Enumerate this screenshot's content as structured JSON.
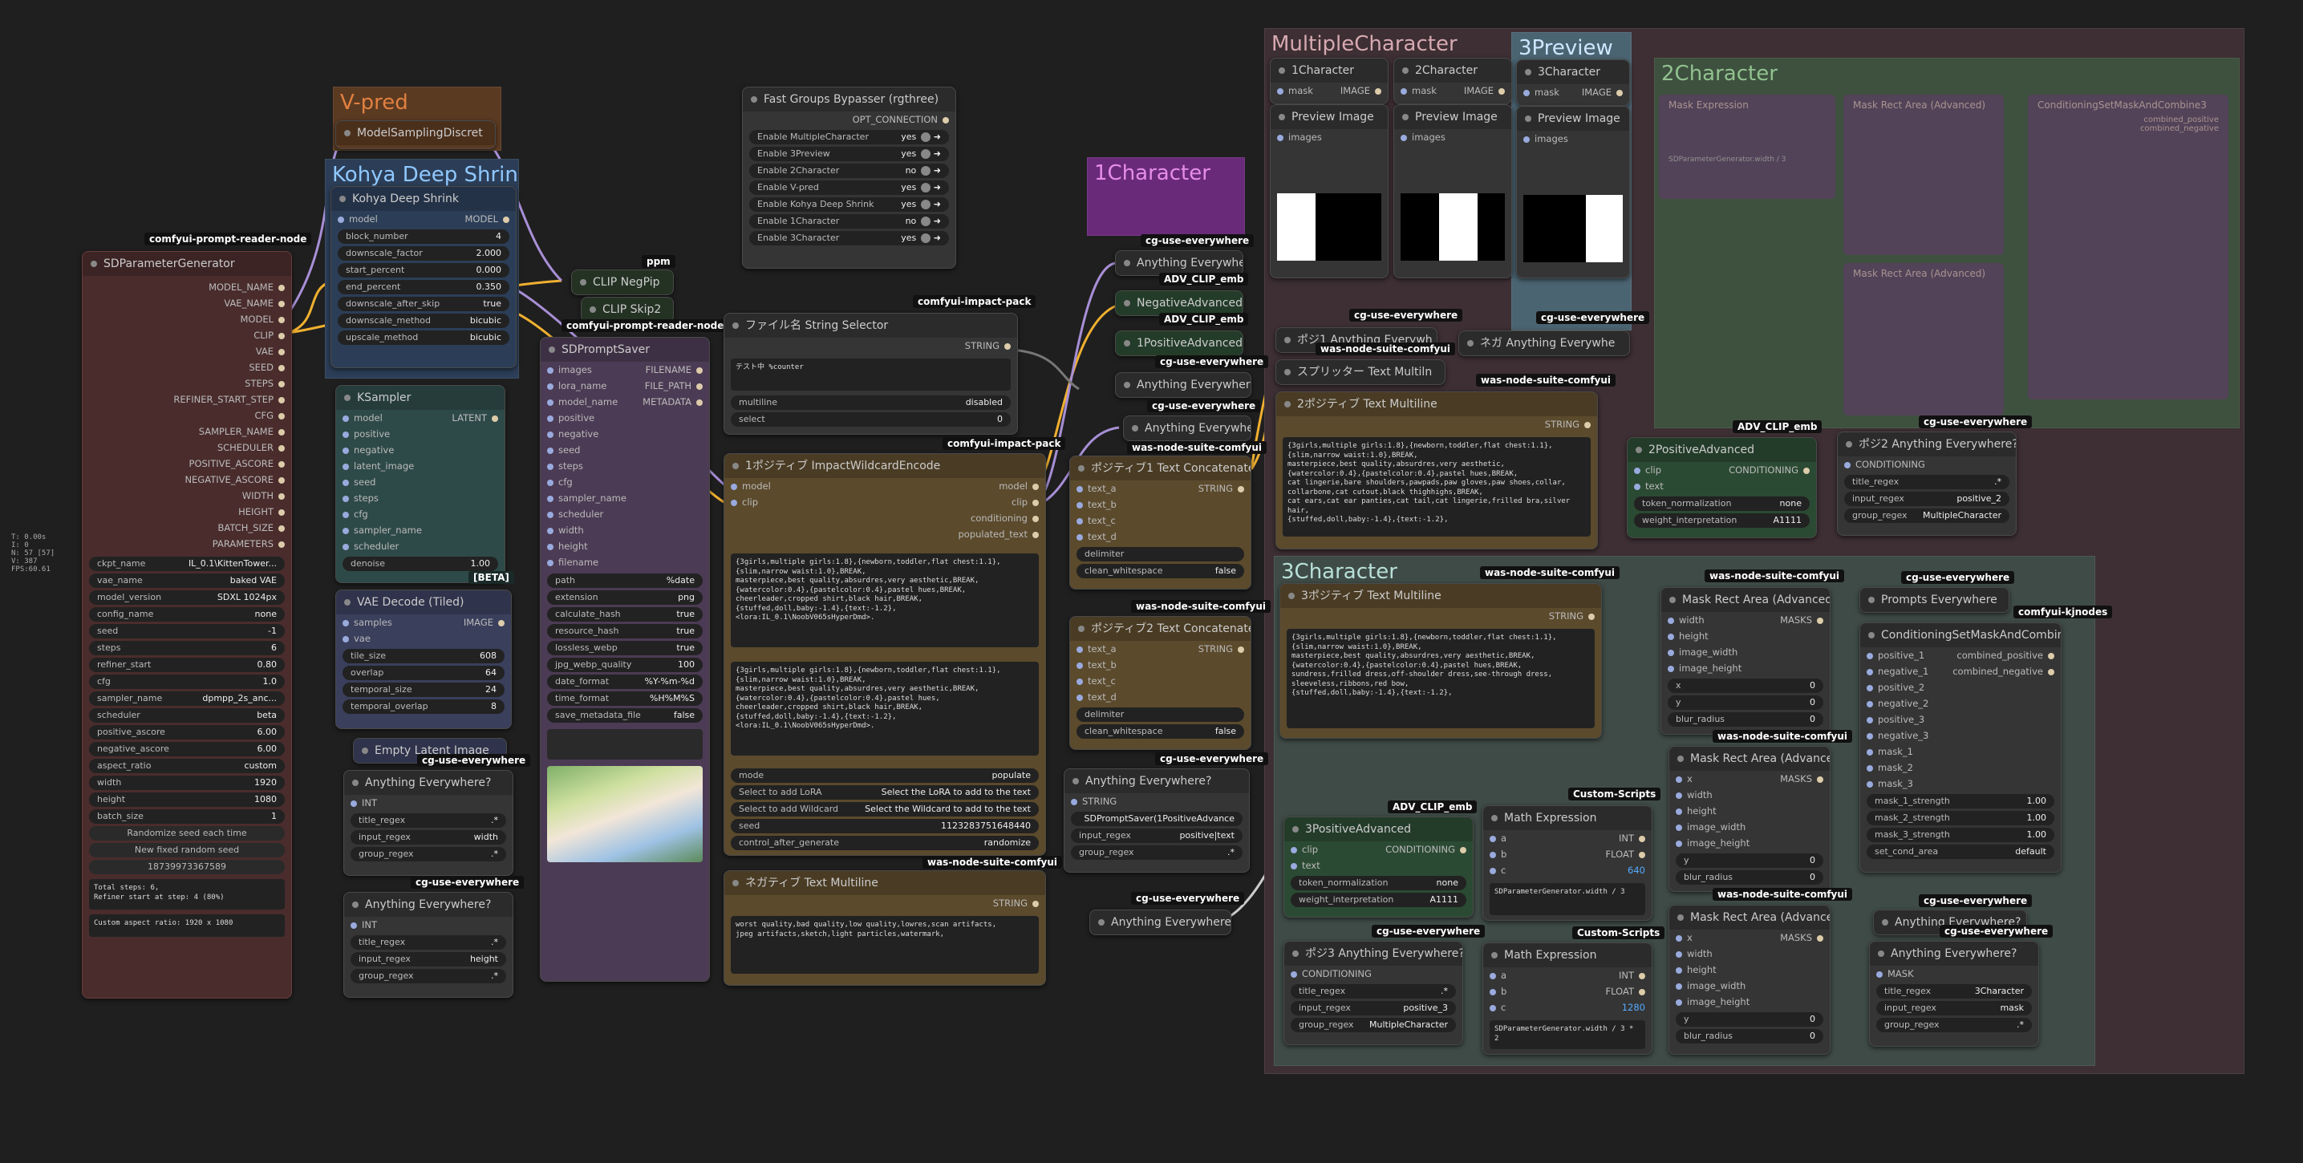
{
  "colors": {
    "green_node": "#2b4a33",
    "brown_node": "#5b4a2c",
    "purple_node": "#4c3b54",
    "teal_node": "#2e4a48",
    "red_node": "#4a2c2c",
    "blue_node": "#3a3f5c"
  },
  "stats": {
    "lines": [
      "T: 0.00s",
      "I: 0",
      "N: 57 [57]",
      "V: 387",
      "FPS:60.61"
    ]
  },
  "groups": {
    "vpred": "V-pred",
    "kohya": "Kohya Deep Shrink",
    "multiple": "MultipleCharacter",
    "preview3": "3Preview",
    "char1": "1Character",
    "char2": "2Character",
    "char3": "3Character"
  },
  "tags": {
    "reader": "comfyui-prompt-reader-node",
    "ppm": "ppm",
    "reader2": "comfyui-prompt-reader-node",
    "impact": "comfyui-impact-pack",
    "impact2": "comfyui-impact-pack",
    "cgue": "cg-use-everywhere",
    "adv": "ADV_CLIP_emb",
    "was": "was-node-suite-comfyui",
    "custom": "Custom-Scripts",
    "kjnodes": "comfyui-kjnodes",
    "beta": "[BETA]"
  },
  "sdparam": {
    "title": "SDParameterGenerator",
    "outputs": [
      "MODEL_NAME",
      "VAE_NAME",
      "MODEL",
      "CLIP",
      "VAE",
      "SEED",
      "STEPS",
      "REFINER_START_STEP",
      "CFG",
      "SAMPLER_NAME",
      "SCHEDULER",
      "POSITIVE_ASCORE",
      "NEGATIVE_ASCORE",
      "WIDTH",
      "HEIGHT",
      "BATCH_SIZE",
      "PARAMETERS"
    ],
    "widgets": [
      {
        "k": "ckpt_name",
        "v": "IL_0.1\\KittenTower..."
      },
      {
        "k": "vae_name",
        "v": "baked VAE"
      },
      {
        "k": "model_version",
        "v": "SDXL 1024px"
      },
      {
        "k": "config_name",
        "v": "none"
      },
      {
        "k": "seed",
        "v": "-1"
      },
      {
        "k": "steps",
        "v": "6"
      },
      {
        "k": "refiner_start",
        "v": "0.80"
      },
      {
        "k": "cfg",
        "v": "1.0"
      },
      {
        "k": "sampler_name",
        "v": "dpmpp_2s_anc..."
      },
      {
        "k": "scheduler",
        "v": "beta"
      },
      {
        "k": "positive_ascore",
        "v": "6.00"
      },
      {
        "k": "negative_ascore",
        "v": "6.00"
      },
      {
        "k": "aspect_ratio",
        "v": "custom"
      },
      {
        "k": "width",
        "v": "1920"
      },
      {
        "k": "height",
        "v": "1080"
      },
      {
        "k": "batch_size",
        "v": "1"
      }
    ],
    "buttons": [
      "Randomize seed each time",
      "New fixed random seed",
      "18739973367589"
    ],
    "info1": "Total steps: 6,\nRefiner start at step: 4 (80%)",
    "info2": "Custom aspect ratio: 1920 x 1080"
  },
  "msd": {
    "title": "ModelSamplingDiscret"
  },
  "kohya": {
    "title": "Kohya Deep Shrink",
    "in": "model",
    "out": "MODEL",
    "widgets": [
      {
        "k": "block_number",
        "v": "4"
      },
      {
        "k": "downscale_factor",
        "v": "2.000"
      },
      {
        "k": "start_percent",
        "v": "0.000"
      },
      {
        "k": "end_percent",
        "v": "0.350"
      },
      {
        "k": "downscale_after_skip",
        "v": "true"
      },
      {
        "k": "downscale_method",
        "v": "bicubic"
      },
      {
        "k": "upscale_method",
        "v": "bicubic"
      }
    ]
  },
  "clipneg": {
    "title": "CLIP NegPip"
  },
  "clipskip": {
    "title": "CLIP Skip2"
  },
  "ksampler": {
    "title": "KSampler",
    "inputs": [
      "model",
      "positive",
      "negative",
      "latent_image",
      "seed",
      "steps",
      "cfg",
      "sampler_name",
      "scheduler"
    ],
    "out": "LATENT",
    "denoise_k": "denoise",
    "denoise_v": "1.00"
  },
  "vaedec": {
    "title": "VAE Decode (Tiled)",
    "inputs": [
      "samples",
      "vae"
    ],
    "out": "IMAGE",
    "widgets": [
      {
        "k": "tile_size",
        "v": "608"
      },
      {
        "k": "overlap",
        "v": "64"
      },
      {
        "k": "temporal_size",
        "v": "24"
      },
      {
        "k": "temporal_overlap",
        "v": "8"
      }
    ]
  },
  "emptylatent": {
    "title": "Empty Latent Image"
  },
  "ae1": {
    "title": "Anything Everywhere?",
    "in": "INT",
    "widgets": [
      {
        "k": "title_regex",
        "v": ".*"
      },
      {
        "k": "input_regex",
        "v": "width"
      },
      {
        "k": "group_regex",
        "v": ".*"
      }
    ]
  },
  "ae2": {
    "title": "Anything Everywhere?",
    "in": "INT",
    "widgets": [
      {
        "k": "title_regex",
        "v": ".*"
      },
      {
        "k": "input_regex",
        "v": "height"
      },
      {
        "k": "group_regex",
        "v": ".*"
      }
    ]
  },
  "saver": {
    "title": "SDPromptSaver",
    "inputs": [
      "images",
      "lora_name",
      "model_name",
      "positive",
      "negative",
      "seed",
      "steps",
      "cfg",
      "sampler_name",
      "scheduler",
      "width",
      "height",
      "filename"
    ],
    "outputs": [
      "FILENAME",
      "FILE_PATH",
      "METADATA"
    ],
    "widgets": [
      {
        "k": "path",
        "v": "%date"
      },
      {
        "k": "extension",
        "v": "png"
      },
      {
        "k": "calculate_hash",
        "v": "true"
      },
      {
        "k": "resource_hash",
        "v": "true"
      },
      {
        "k": "lossless_webp",
        "v": "true"
      },
      {
        "k": "jpg_webp_quality",
        "v": "100"
      },
      {
        "k": "date_format",
        "v": "%Y-%m-%d"
      },
      {
        "k": "time_format",
        "v": "%H%M%S"
      },
      {
        "k": "save_metadata_file",
        "v": "false"
      }
    ]
  },
  "bypass": {
    "title": "Fast Groups Bypasser (rgthree)",
    "out": "OPT_CONNECTION",
    "rows": [
      {
        "k": "Enable MultipleCharacter",
        "v": "yes"
      },
      {
        "k": "Enable 3Preview",
        "v": "yes"
      },
      {
        "k": "Enable 2Character",
        "v": "no"
      },
      {
        "k": "Enable V-pred",
        "v": "yes"
      },
      {
        "k": "Enable Kohya Deep Shrink",
        "v": "yes"
      },
      {
        "k": "Enable 1Character",
        "v": "no"
      },
      {
        "k": "Enable 3Character",
        "v": "yes"
      }
    ]
  },
  "fname": {
    "title": "ファイル名 String Selector",
    "out": "STRING",
    "text": "テスト中 %counter",
    "widgets": [
      {
        "k": "multiline",
        "v": "disabled"
      },
      {
        "k": "select",
        "v": "0"
      }
    ]
  },
  "wildcard": {
    "title": "1ポジティブ ImpactWildcardEncode",
    "inputs": [
      "model",
      "clip"
    ],
    "outputs": [
      "model",
      "clip",
      "conditioning",
      "populated_text"
    ],
    "text1": "{3girls,multiple girls:1.8},{newborn,toddler,flat chest:1.1},{slim,narrow waist:1.0},BREAK,\nmasterpiece,best quality,absurdres,very aesthetic,BREAK,\n{watercolor:0.4},{pastelcolor:0.4},pastel hues,BREAK,\ncheerleader,cropped shirt,black hair,BREAK,\n{stuffed,doll,baby:-1.4},{text:-1.2},\n<lora:IL_0.1\\NoobV065sHyperDmd>.",
    "text2": "{3girls,multiple girls:1.8},{newborn,toddler,flat chest:1.1},{slim,narrow waist:1.0},BREAK,\nmasterpiece,best quality,absurdres,very aesthetic,BREAK,\n{watercolor:0.4},{pastelcolor:0.4},pastel hues,\ncheerleader,cropped shirt,black hair,BREAK,\n{stuffed,doll,baby:-1.4},{text:-1.2},\n<lora:IL_0.1\\NoobV065sHyperDmd>.",
    "widgets": [
      {
        "k": "mode",
        "v": "populate"
      },
      {
        "k": "Select to add LoRA",
        "v": "Select the LoRA to add to the text"
      },
      {
        "k": "Select to add Wildcard",
        "v": "Select the Wildcard to add to the text"
      },
      {
        "k": "seed",
        "v": "1123283751648440"
      },
      {
        "k": "control_after_generate",
        "v": "randomize"
      }
    ]
  },
  "negtext": {
    "title": "ネガティブ Text Multiline",
    "out": "STRING",
    "text": "worst quality,bad quality,low quality,lowres,scan artifacts,\njpeg artifacts,sketch,light particles,watermark,"
  },
  "ae_small": {
    "a": "Anything Everywhere",
    "b": "Anything Everywhere?",
    "c": "Anything Everywhere",
    "d": "Anything Everywhere?"
  },
  "negadv": {
    "title": "NegativeAdvanced"
  },
  "posadv1": {
    "title": "1PositiveAdvanced"
  },
  "concat1": {
    "title": "ポジティブ1 Text Concatenate",
    "inputs": [
      "text_a",
      "text_b",
      "text_c",
      "text_d"
    ],
    "out": "STRING",
    "widgets": [
      {
        "k": "delimiter",
        "v": ""
      },
      {
        "k": "clean_whitespace",
        "v": "false"
      }
    ]
  },
  "concat2": {
    "title": "ポジティブ2 Text Concatenate",
    "inputs": [
      "text_a",
      "text_b",
      "text_c",
      "text_d"
    ],
    "out": "STRING",
    "widgets": [
      {
        "k": "delimiter",
        "v": ""
      },
      {
        "k": "clean_whitespace",
        "v": "false"
      }
    ]
  },
  "aeq_string": {
    "title": "Anything Everywhere?",
    "in": "STRING",
    "widgets": [
      {
        "k": "",
        "v": "SDPromptSaver(1PositiveAdvance"
      },
      {
        "k": "input_regex",
        "v": "positive|text"
      },
      {
        "k": "group_regex",
        "v": ".*"
      }
    ]
  },
  "mc": {
    "c1": {
      "title": "1Character",
      "in": "mask",
      "out": "IMAGE",
      "prev": "Preview Image",
      "prevIn": "images"
    },
    "c2": {
      "title": "2Character",
      "in": "mask",
      "out": "IMAGE",
      "prev": "Preview Image",
      "prevIn": "images"
    },
    "c3": {
      "title": "3Character",
      "in": "mask",
      "out": "IMAGE",
      "prev": "Preview Image",
      "prevIn": "images"
    }
  },
  "pos1ae": {
    "title": "ポジ1 Anything Everywh"
  },
  "neg_ae": {
    "title": "ネガ Anything Everywhe"
  },
  "splitter": {
    "title": "スプリッター Text Multiln"
  },
  "pos2text": {
    "title": "2ポジティブ Text Multiline",
    "out": "STRING",
    "text": "{3girls,multiple girls:1.8},{newborn,toddler,flat chest:1.1},\n{slim,narrow waist:1.0},BREAK,\nmasterpiece,best quality,absurdres,very aesthetic,\n{watercolor:0.4},{pastelcolor:0.4},pastel hues,BREAK,\ncat lingerie,bare shoulders,pawpads,paw gloves,paw shoes,collar,\ncollarbone,cat cutout,black thighhighs,BREAK,\ncat ears,cat ear panties,cat tail,cat lingerie,frilled bra,silver hair,\n{stuffed,doll,baby:-1.4},{text:-1.2},"
  },
  "pos2adv": {
    "title": "2PositiveAdvanced",
    "inputs": [
      "clip",
      "text"
    ],
    "out": "CONDITIONING",
    "widgets": [
      {
        "k": "token_normalization",
        "v": "none"
      },
      {
        "k": "weight_interpretation",
        "v": "A1111"
      }
    ]
  },
  "pos2ae": {
    "title": "ポジ2 Anything Everywhere?",
    "in": "CONDITIONING",
    "widgets": [
      {
        "k": "title_regex",
        "v": ".*"
      },
      {
        "k": "input_regex",
        "v": "positive_2"
      },
      {
        "k": "group_regex",
        "v": "MultipleCharacter"
      }
    ]
  },
  "pos3text": {
    "title": "3ポジティブ Text Multiline",
    "out": "STRING",
    "text": "{3girls,multiple girls:1.8},{newborn,toddler,flat chest:1.1},\n{slim,narrow waist:1.0},BREAK,\nmasterpiece,best quality,absurdres,very aesthetic,BREAK,\n{watercolor:0.4},{pastelcolor:0.4},pastel hues,BREAK,\nsundress,frilled dress,off-shoulder dress,see-through dress,\nsleeveless,ribbons,red bow,\n{stuffed,doll,baby:-1.4},{text:-1.2},"
  },
  "pos3adv": {
    "title": "3PositiveAdvanced",
    "inputs": [
      "clip",
      "text"
    ],
    "out": "CONDITIONING",
    "widgets": [
      {
        "k": "token_normalization",
        "v": "none"
      },
      {
        "k": "weight_interpretation",
        "v": "A1111"
      }
    ]
  },
  "pos3ae": {
    "title": "ポジ3 Anything Everywhere?",
    "in": "CONDITIONING",
    "widgets": [
      {
        "k": "title_regex",
        "v": ".*"
      },
      {
        "k": "input_regex",
        "v": "positive_3"
      },
      {
        "k": "group_regex",
        "v": "MultipleCharacter"
      }
    ]
  },
  "math1": {
    "title": "Math Expression",
    "inputs": [
      "a",
      "b",
      "c"
    ],
    "outputs": [
      "INT",
      "FLOAT"
    ],
    "val": "640",
    "expr": "SDParameterGenerator.width / 3"
  },
  "math2": {
    "title": "Math Expression",
    "inputs": [
      "a",
      "b",
      "c"
    ],
    "outputs": [
      "INT",
      "FLOAT"
    ],
    "val": "1280",
    "expr": "SDParameterGenerator.width / 3 * 2"
  },
  "mask1": {
    "title": "Mask Rect Area (Advanced)",
    "inputs": [
      "width",
      "height",
      "image_width",
      "image_height"
    ],
    "out": "MASKS",
    "widgets": [
      {
        "k": "x",
        "v": "0"
      },
      {
        "k": "y",
        "v": "0"
      },
      {
        "k": "blur_radius",
        "v": "0"
      }
    ]
  },
  "mask2": {
    "title": "Mask Rect Area (Advanced)",
    "inputs": [
      "x",
      "width",
      "height",
      "image_width",
      "image_height"
    ],
    "out": "MASKS",
    "widgets": [
      {
        "k": "y",
        "v": "0"
      },
      {
        "k": "blur_radius",
        "v": "0"
      }
    ]
  },
  "mask3": {
    "title": "Mask Rect Area (Advanced)",
    "inputs": [
      "x",
      "width",
      "height",
      "image_width",
      "image_height"
    ],
    "out": "MASKS",
    "widgets": [
      {
        "k": "y",
        "v": "0"
      },
      {
        "k": "blur_radius",
        "v": "0"
      }
    ]
  },
  "prompts_ae": {
    "title": "Prompts Everywhere"
  },
  "combine": {
    "title": "ConditioningSetMaskAndCombine3",
    "inputs": [
      "positive_1",
      "negative_1",
      "positive_2",
      "negative_2",
      "positive_3",
      "negative_3",
      "mask_1",
      "mask_2",
      "mask_3"
    ],
    "outputs": [
      "combined_positive",
      "combined_negative"
    ],
    "widgets": [
      {
        "k": "mask_1_strength",
        "v": "1.00"
      },
      {
        "k": "mask_2_strength",
        "v": "1.00"
      },
      {
        "k": "mask_3_strength",
        "v": "1.00"
      },
      {
        "k": "set_cond_area",
        "v": "default"
      }
    ]
  },
  "ae_any": {
    "title": "Anything Everywhere?"
  },
  "ae_mask": {
    "title": "Anything Everywhere?",
    "in": "MASK",
    "widgets": [
      {
        "k": "title_regex",
        "v": "3Character"
      },
      {
        "k": "input_regex",
        "v": "mask"
      },
      {
        "k": "group_regex",
        "v": ".*"
      }
    ]
  },
  "c2dim": {
    "custom": "Custom-Scripts",
    "was": "was-node-suite-comfyui",
    "kj": "comfyui-kjnodes",
    "expr": "SDParameterGenerator.width / 3",
    "mask": "Mask Expression",
    "rect": "Mask Rect Area (Advanced)",
    "combine": "ConditioningSetMaskAndCombine3",
    "cpos": "combined_positive",
    "cneg": "combined_negative"
  }
}
